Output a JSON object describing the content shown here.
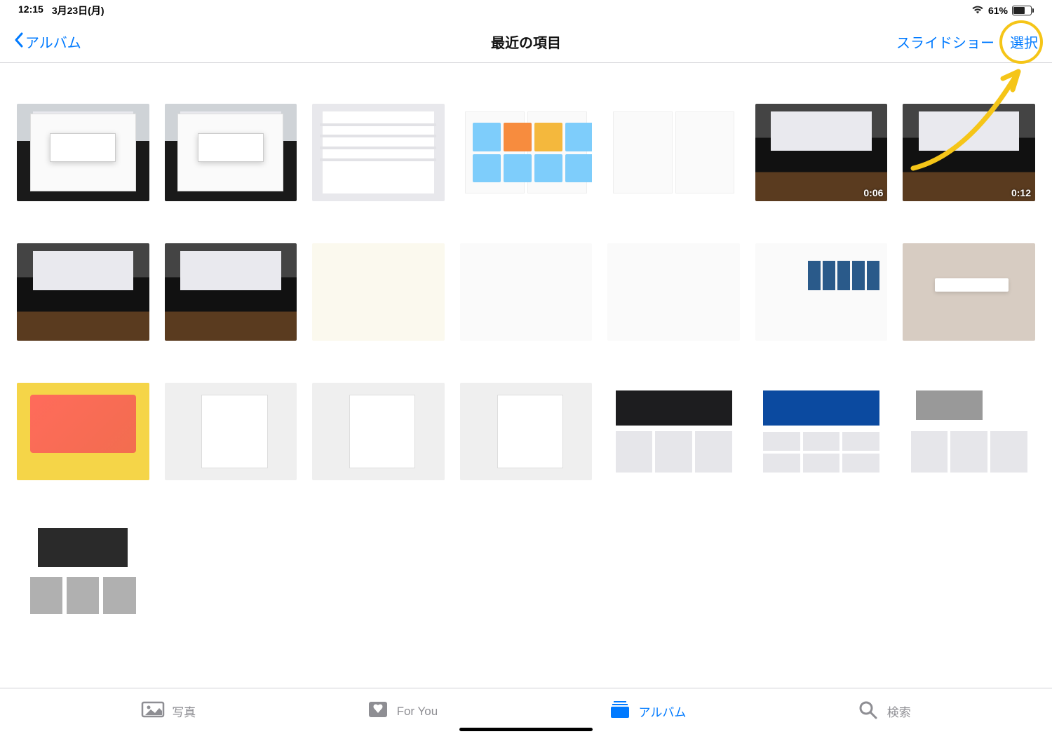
{
  "status": {
    "time": "12:15",
    "date": "3月23日(月)",
    "battery_pct": "61%"
  },
  "nav": {
    "back_label": "アルバム",
    "title": "最近の項目",
    "slideshow_label": "スライドショー",
    "select_label": "選択"
  },
  "videos": {
    "v1_duration": "0:06",
    "v2_duration": "0:12"
  },
  "tabs": {
    "photos": "写真",
    "foryou": "For You",
    "albums": "アルバム",
    "search": "検索"
  }
}
